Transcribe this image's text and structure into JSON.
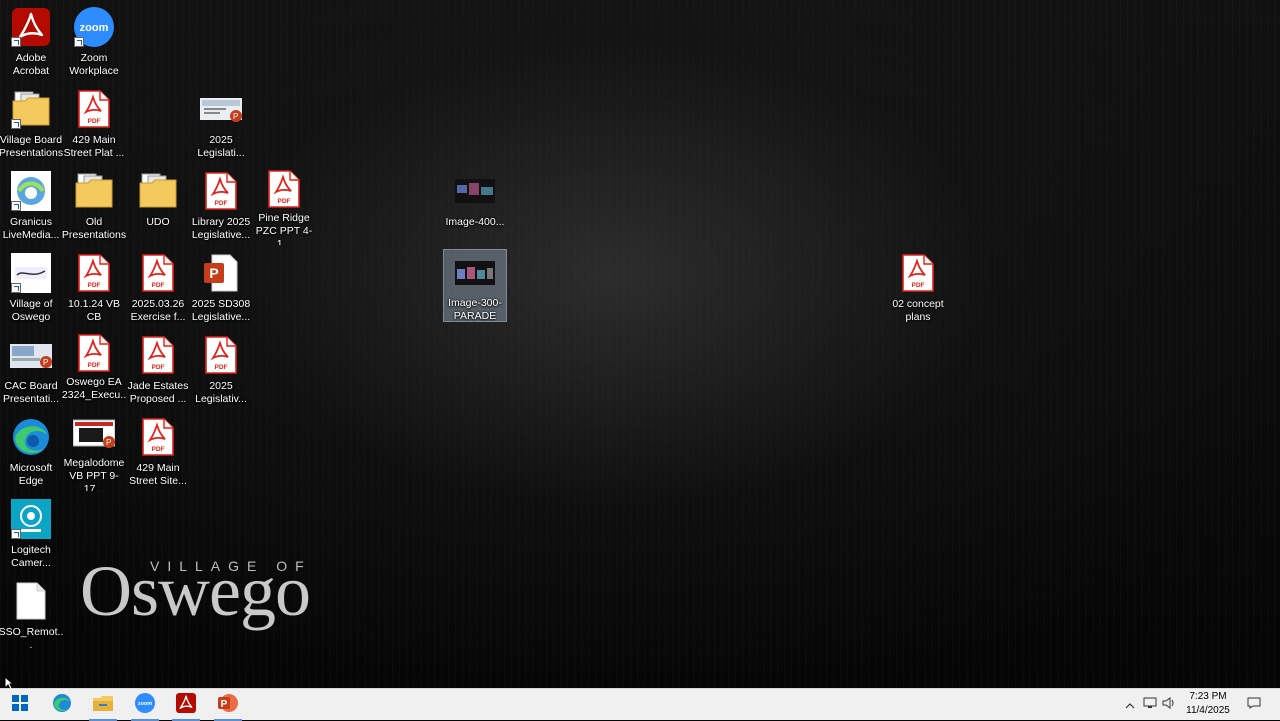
{
  "desktop": {
    "icons": [
      {
        "label": "Adobe Acrobat",
        "type": "acrobat"
      },
      {
        "label": "Zoom Workplace",
        "type": "zoom"
      },
      {
        "label": "Village Board Presentations",
        "type": "folder-docs"
      },
      {
        "label": "429 Main Street Plat ...",
        "type": "pdf"
      },
      {
        "label": "2025 Legislati...",
        "type": "ppt-thumb"
      },
      {
        "label": "Granicus LiveMedia...",
        "type": "granicus"
      },
      {
        "label": "Old Presentations",
        "type": "folder-docs"
      },
      {
        "label": "UDO",
        "type": "folder-docs"
      },
      {
        "label": "Library 2025 Legislative...",
        "type": "pdf"
      },
      {
        "label": "Pine Ridge PZC PPT 4-1...",
        "type": "pdf"
      },
      {
        "label": "Image-400...",
        "type": "image-thumb"
      },
      {
        "label": "Village of Oswego",
        "type": "oswego-thumb"
      },
      {
        "label": "10.1.24 VB CB",
        "type": "pdf"
      },
      {
        "label": "2025.03.26 Exercise f...",
        "type": "pdf"
      },
      {
        "label": "2025 SD308 Legislative...",
        "type": "ppt"
      },
      {
        "label": "Image-300-PARADE",
        "type": "image-thumb"
      },
      {
        "label": "02 concept plans",
        "type": "pdf"
      },
      {
        "label": "CAC Board Presentati...",
        "type": "ppt-thumb"
      },
      {
        "label": "Oswego EA 2324_Execu...",
        "type": "pdf"
      },
      {
        "label": "Jade Estates Proposed ...",
        "type": "pdf"
      },
      {
        "label": "2025 Legislativ...",
        "type": "pdf"
      },
      {
        "label": "Microsoft Edge",
        "type": "edge"
      },
      {
        "label": "Megalodome VB PPT 9-17...",
        "type": "ppt-thumb-dark"
      },
      {
        "label": "429 Main Street Site...",
        "type": "pdf"
      },
      {
        "label": "Logitech Camer...",
        "type": "logitech"
      },
      {
        "label": "SSO_Remot...",
        "type": "blank"
      }
    ],
    "wallpaper_logo": {
      "top": "VILLAGE OF",
      "main": "Oswego"
    }
  },
  "taskbar": {
    "apps": [
      "windows-start-icon",
      "edge-icon",
      "file-explorer-icon",
      "zoom-icon",
      "acrobat-icon",
      "powerpoint-icon"
    ],
    "clock_time": "7:23 PM",
    "clock_date": "11/4/2025"
  },
  "colors": {
    "pdf_red": "#e3231b",
    "zoom_blue": "#2d8cff",
    "ppt_orange": "#c43e1c",
    "taskbar": "#f0f0f0"
  }
}
